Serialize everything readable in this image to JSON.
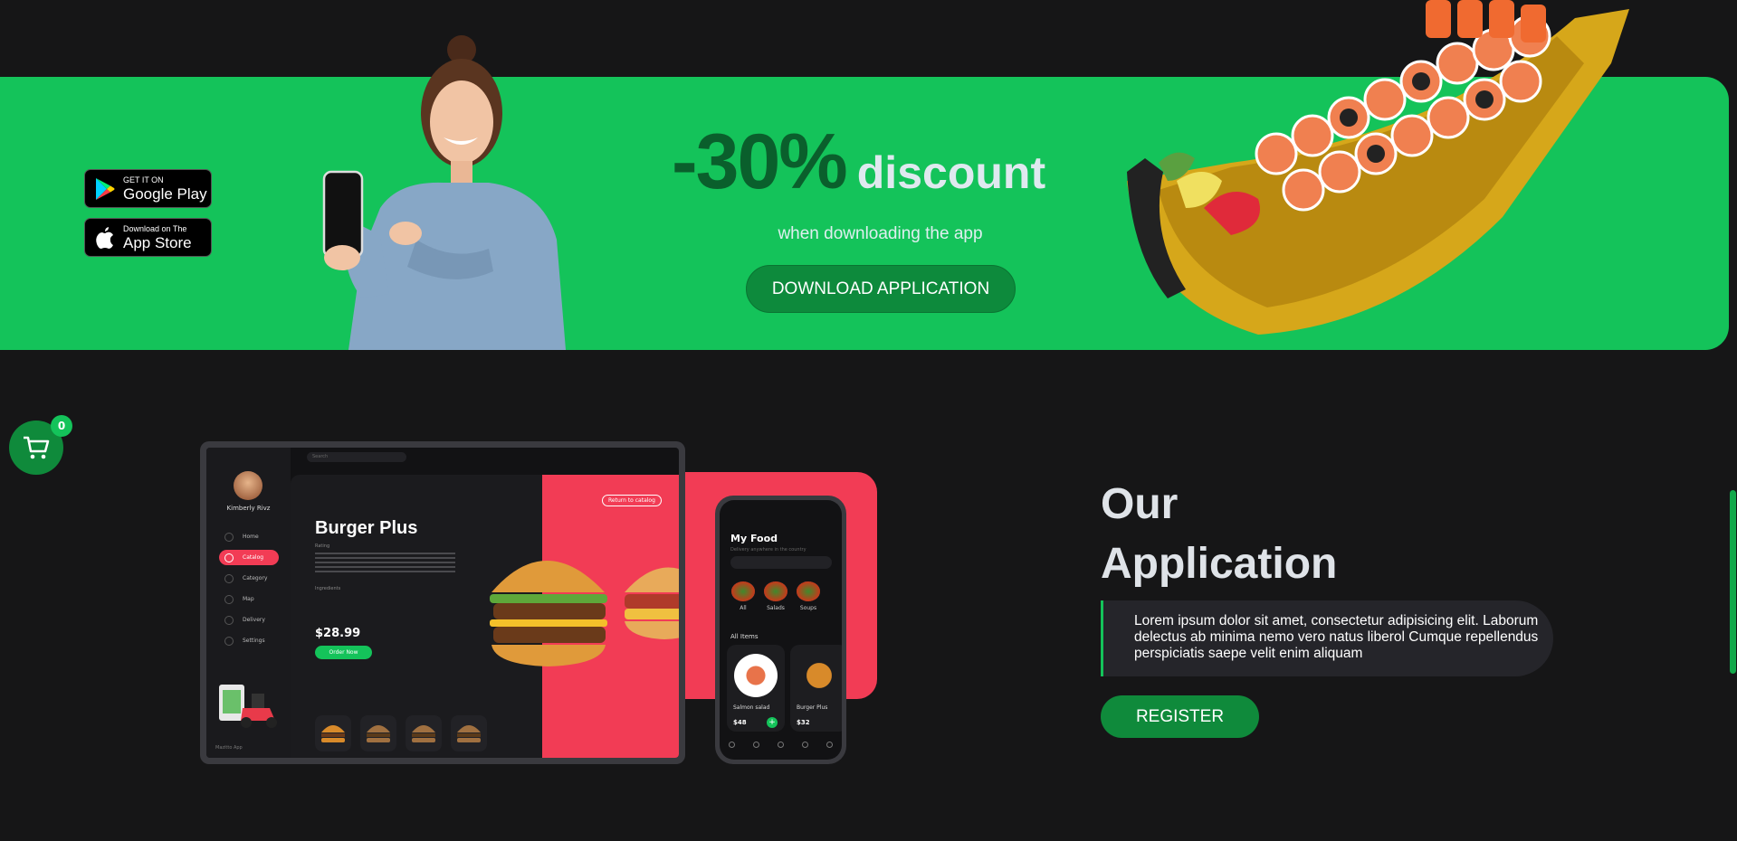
{
  "banner": {
    "google_play": {
      "small": "GET IT ON",
      "large": "Google Play"
    },
    "app_store": {
      "small": "Download on The",
      "large": "App Store"
    },
    "headline_percent": "-30%",
    "headline_word": "discount",
    "subtext": "when downloading the app",
    "download_button": "DOWNLOAD APPLICATION"
  },
  "cart": {
    "count": "0"
  },
  "tablet": {
    "user_name": "Kimberly Rivz",
    "search_placeholder": "Search",
    "nav": [
      "Home",
      "Catalog",
      "Category",
      "Map",
      "Delivery",
      "Settings"
    ],
    "product_title": "Burger Plus",
    "rating_label": "Rating",
    "ingredients_label": "Ingredients",
    "price": "$28.99",
    "order_button": "Order Now",
    "return_button": "Return to catalog",
    "footer": "Mazitto App"
  },
  "phone": {
    "title": "My Food",
    "subtitle": "Delivery anywhere in the country",
    "categories": [
      "All",
      "Salads",
      "Soups"
    ],
    "all_items_label": "All Items",
    "items": [
      {
        "name": "Salmon salad",
        "price": "$48"
      },
      {
        "name": "Burger Plus",
        "price": "$32"
      }
    ]
  },
  "app_section": {
    "title_line1": "Our",
    "title_line2": "Application",
    "description": "Lorem ipsum dolor sit amet, consectetur adipisicing elit. Laborum delectus ab minima nemo vero natus liberol Cumque repellendus perspiciatis saepe velit enim aliquam",
    "register_button": "REGISTER"
  },
  "colors": {
    "accent_green": "#14c35a",
    "dark_green": "#0f8a3b",
    "accent_red": "#f23c55",
    "background": "#161617"
  }
}
